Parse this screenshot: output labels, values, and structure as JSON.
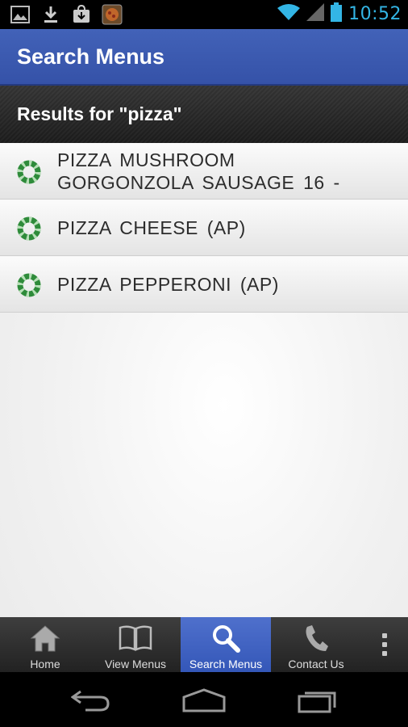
{
  "status_bar": {
    "time": "10:52",
    "notification_icons": [
      "picture-icon",
      "download-icon",
      "store-download-icon",
      "app-thumbnail-icon"
    ],
    "system_icons": [
      "wifi-icon",
      "signal-icon",
      "battery-icon"
    ]
  },
  "action_bar": {
    "title": "Search Menus"
  },
  "results": {
    "header": "Results for \"pizza\"",
    "items": [
      {
        "label": "PIZZA  MUSHROOM  GORGONZOLA  SAUSAGE  16 -"
      },
      {
        "label": "PIZZA  CHEESE (AP)"
      },
      {
        "label": "PIZZA  PEPPERONI (AP)"
      }
    ]
  },
  "tab_bar": {
    "tabs": [
      {
        "label": "Home",
        "icon": "home-icon"
      },
      {
        "label": "View Menus",
        "icon": "book-icon"
      },
      {
        "label": "Search Menus",
        "icon": "search-icon",
        "active": true
      },
      {
        "label": "Contact Us",
        "icon": "phone-icon"
      }
    ],
    "overflow_icon": "overflow-menu-icon"
  },
  "nav_bar": {
    "buttons": [
      "back-icon",
      "home-nav-icon",
      "recent-apps-icon"
    ]
  },
  "colors": {
    "action_bar": "#3a58ad",
    "active_tab": "#4265c4",
    "accent": "#33b5e5",
    "ring_green": "#2e8b3a"
  }
}
